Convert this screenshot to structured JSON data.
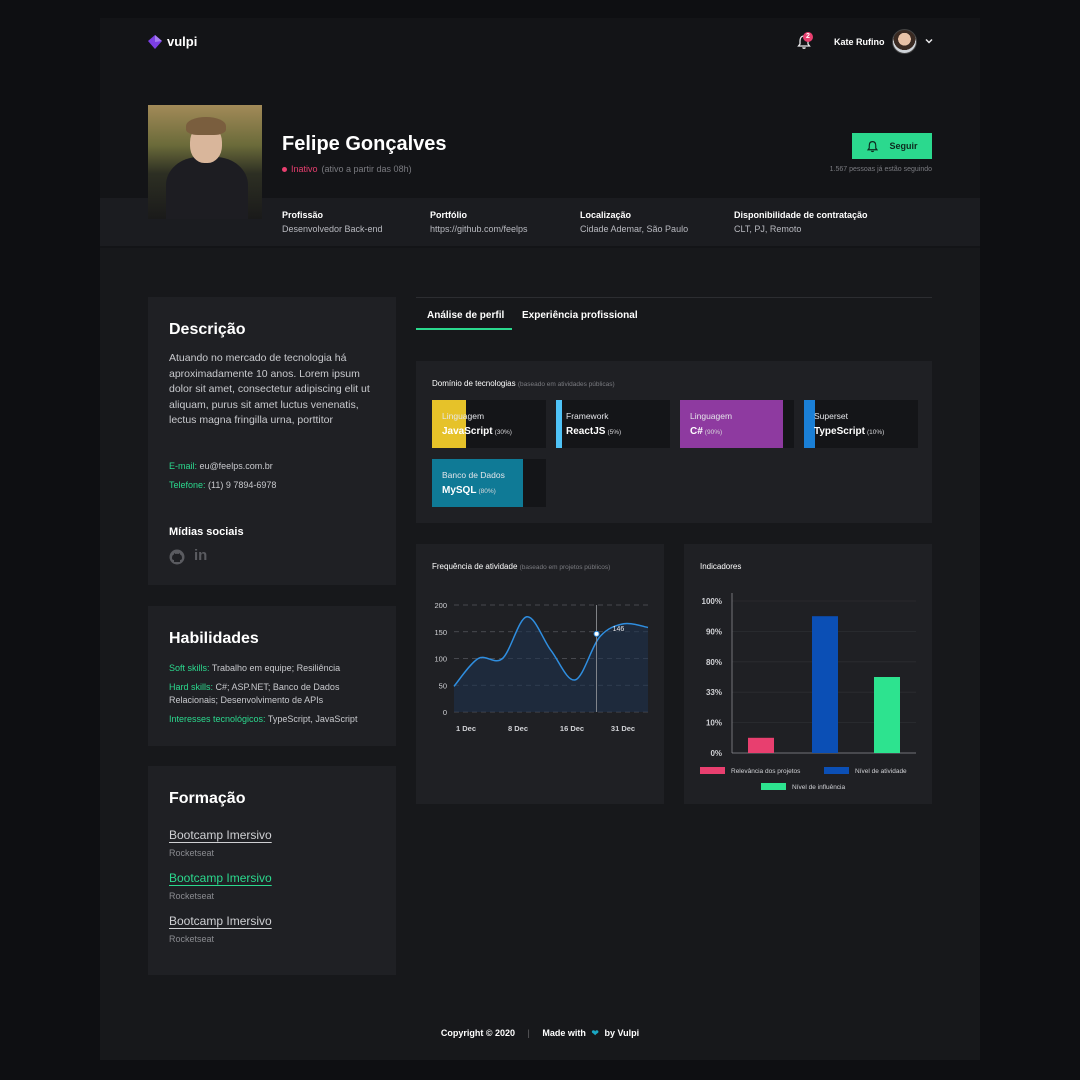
{
  "header": {
    "brand": "vulpi",
    "notifications_count": "2",
    "user_name": "Kate Rufino"
  },
  "profile": {
    "name": "Felipe Gonçalves",
    "status": "Inativo",
    "status_since": "(ativo a partir das 08h)",
    "follow_label": "Seguir",
    "followers_text": "1.567 pessoas já estão seguindo",
    "info": [
      {
        "label": "Profissão",
        "value": "Desenvolvedor Back-end"
      },
      {
        "label": "Portfólio",
        "value": "https://github.com/feelps"
      },
      {
        "label": "Localização",
        "value": "Cidade Ademar, São Paulo"
      },
      {
        "label": "Disponibilidade de contratação",
        "value": "CLT, PJ, Remoto"
      }
    ]
  },
  "description": {
    "title": "Descrição",
    "text": "Atuando no mercado de tecnologia há aproximadamente 10 anos. Lorem ipsum dolor sit amet, consectetur adipiscing elit ut aliquam, purus sit amet luctus venenatis, lectus magna fringilla urna, porttitor",
    "email_label": "E-mail:",
    "email": "eu@feelps.com.br",
    "phone_label": "Telefone:",
    "phone": "(11) 9 7894-6978",
    "social_title": "Mídias sociais",
    "social_icons": [
      "github-icon",
      "linkedin-icon"
    ]
  },
  "skills": {
    "title": "Habilidades",
    "soft_label": "Soft skills:",
    "soft": "Trabalho em equipe; Resiliência",
    "hard_label": "Hard skills:",
    "hard": "C#; ASP.NET; Banco de Dados Relacionais; Desenvolvimento de APIs",
    "interests_label": "Interesses tecnológicos:",
    "interests": "TypeScript, JavaScript"
  },
  "education": {
    "title": "Formação",
    "items": [
      {
        "course": "Bootcamp Imersivo",
        "school": "Rocketseat"
      },
      {
        "course": "Bootcamp Imersivo",
        "school": "Rocketseat"
      },
      {
        "course": "Bootcamp Imersivo",
        "school": "Rocketseat"
      }
    ]
  },
  "tabs": [
    "Análise de perfil",
    "Experiência profissional"
  ],
  "tech_domain": {
    "title": "Domínio de tecnologias",
    "hint": "(baseado em atividades públicas)",
    "items": [
      {
        "category": "Linguagem",
        "name": "JavaScript",
        "percent_label": "(30%)",
        "percent": 30,
        "color": "#e6c229"
      },
      {
        "category": "Framework",
        "name": "ReactJS",
        "percent_label": "(5%)",
        "percent": 5,
        "color": "#4fc3f7"
      },
      {
        "category": "Linguagem",
        "name": "C#",
        "percent_label": "(90%)",
        "percent": 90,
        "color": "#8e3aa0"
      },
      {
        "category": "Superset",
        "name": "TypeScript",
        "percent_label": "(10%)",
        "percent": 10,
        "color": "#1a7fd6"
      },
      {
        "category": "Banco de Dados",
        "name": "MySQL",
        "percent_label": "(80%)",
        "percent": 80,
        "color": "#0f7a96"
      }
    ]
  },
  "activity": {
    "title": "Frequência de atividade",
    "hint": "(baseado em projetos públicos)"
  },
  "indicators": {
    "title": "Indicadores"
  },
  "chart_data": [
    {
      "type": "area",
      "title": "Frequência de atividade",
      "x": [
        "1 Dec",
        "8 Dec",
        "16 Dec",
        "31 Dec"
      ],
      "y_ticks": [
        0,
        50,
        100,
        150,
        200
      ],
      "ylim": [
        0,
        200
      ],
      "series": [
        {
          "values": [
            48,
            100,
            100,
            178,
            115,
            60,
            140,
            165,
            158
          ]
        }
      ],
      "annotation": {
        "label": "146",
        "value": 146
      },
      "grid": true,
      "line_color": "#2f8ee0"
    },
    {
      "type": "bar",
      "title": "Indicadores",
      "y_ticks": [
        "100%",
        "90%",
        "80%",
        "33%",
        "10%",
        "0%"
      ],
      "series": [
        {
          "name": "Relevância dos projetos",
          "value": 10,
          "color": "#e83f6f"
        },
        {
          "name": "Nível de atividade",
          "value": 90,
          "color": "#0b4fb5"
        },
        {
          "name": "Nível de influência",
          "value": 50,
          "color": "#2de38f"
        }
      ],
      "grid": true,
      "legend": "bottom"
    }
  ],
  "footer": {
    "copyright": "Copyright © 2020",
    "made_with": "Made with",
    "by": "by Vulpi"
  }
}
